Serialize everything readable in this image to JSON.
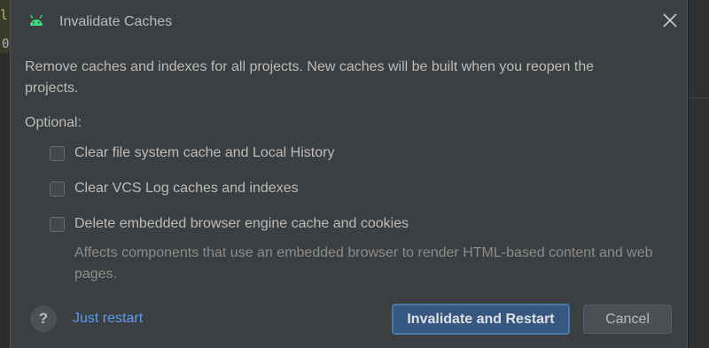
{
  "background": {
    "editor_glyph_top": "l",
    "editor_glyph_bottom": "0"
  },
  "dialog": {
    "title": "Invalidate Caches",
    "app_icon": "android-icon",
    "close_icon": "close-icon",
    "message": "Remove caches and indexes for all projects. New caches will be built when you reopen the projects.",
    "optional_label": "Optional:",
    "options": [
      {
        "label": "Clear file system cache and Local History",
        "checked": false
      },
      {
        "label": "Clear VCS Log caches and indexes",
        "checked": false
      },
      {
        "label": "Delete embedded browser engine cache and cookies",
        "checked": false
      }
    ],
    "option_note": "Affects components that use an embedded browser to render HTML-based content and web pages.",
    "help_label": "?",
    "just_restart_label": "Just restart",
    "primary_button_label": "Invalidate and Restart",
    "cancel_button_label": "Cancel"
  },
  "colors": {
    "dialog_bg": "#3c3f41",
    "text": "#bbbbbb",
    "muted_text": "#8c8c8c",
    "link": "#589df6",
    "primary_button": "#365880",
    "android_green": "#3ddc84"
  }
}
